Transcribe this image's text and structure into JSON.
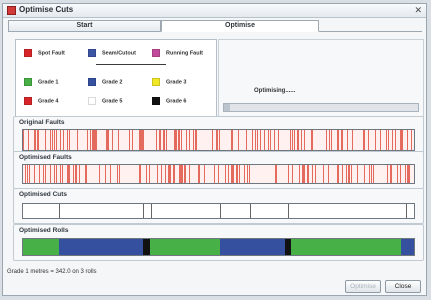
{
  "window": {
    "title": "Optimise Cuts",
    "close_glyph": "✕"
  },
  "tabs": [
    {
      "label": "Start"
    },
    {
      "label": "Optimise"
    }
  ],
  "legend": {
    "items": [
      {
        "label": "Spot Fault",
        "color": "#d8252a"
      },
      {
        "label": "Seam/Cutout",
        "color": "#3c55a5"
      },
      {
        "label": "Running Fault",
        "color": "#c34b9b"
      },
      {
        "label": "Grade 1",
        "color": "#47b046"
      },
      {
        "label": "Grade 2",
        "color": "#3650a0"
      },
      {
        "label": "Grade 3",
        "color": "#f0e826"
      },
      {
        "label": "Grade 4",
        "color": "#d8252a"
      },
      {
        "label": "Grade 5",
        "color": "#ffffff"
      },
      {
        "label": "Grade 6",
        "color": "#111111"
      }
    ]
  },
  "progress": {
    "status_text": "Optimising......",
    "fraction": 0.03
  },
  "sections": {
    "original_faults": "Original Faults",
    "optimised_faults": "Optimised Faults",
    "optimised_cuts": "Optimised Cuts",
    "optimised_rolls": "Optimised Rolls"
  },
  "status_bar": "Grade 1 metres = 342.0 on 3 rolls",
  "buttons": {
    "optimise": "Optimise",
    "close": "Close"
  },
  "colors": {
    "fault_tick": "#e36a5c",
    "grade1": "#47b046",
    "grade2": "#3650a0",
    "grade6": "#111111"
  }
}
